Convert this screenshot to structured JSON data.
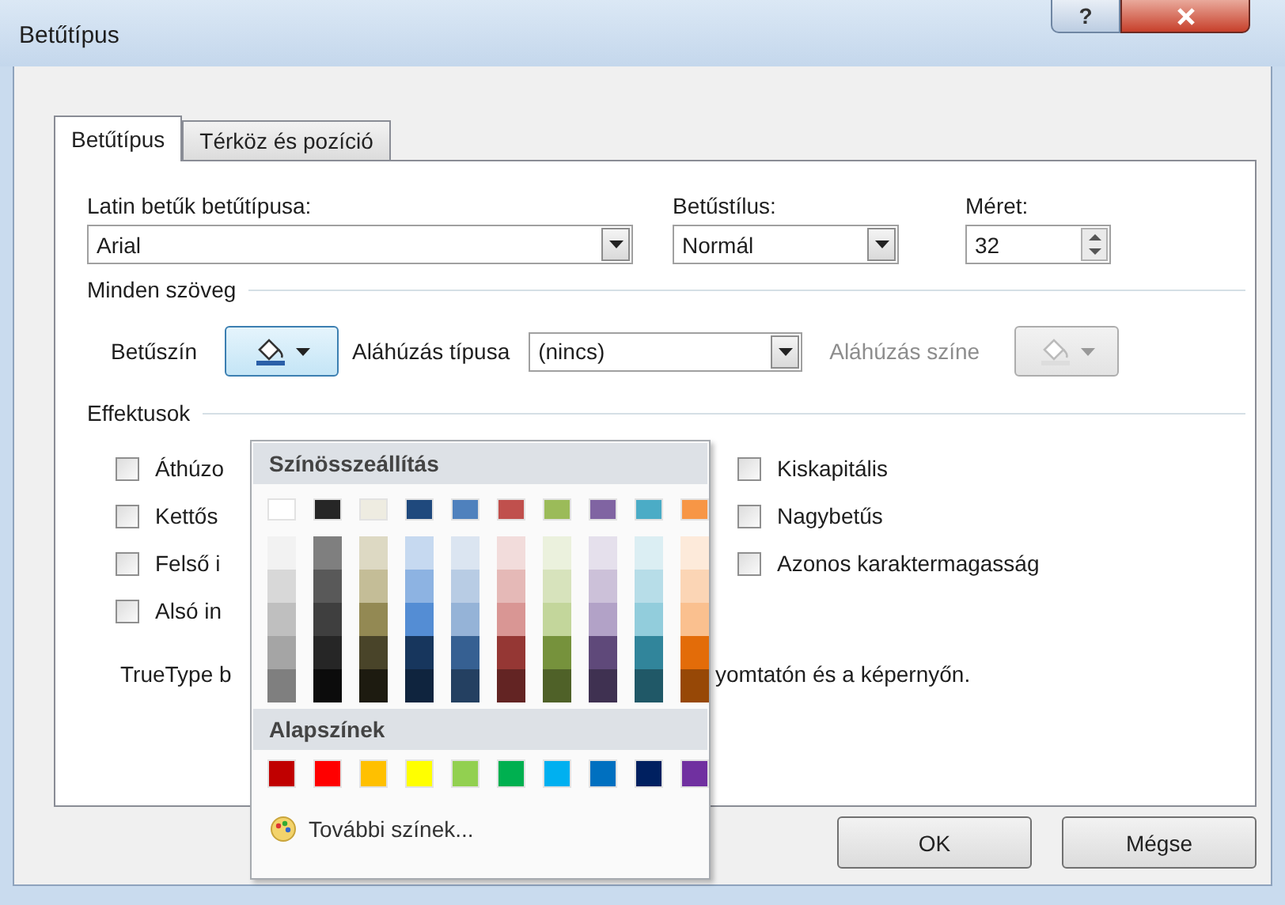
{
  "window": {
    "title": "Betűtípus",
    "help": "?"
  },
  "tabs": [
    {
      "label": "Betűtípus",
      "selected": true
    },
    {
      "label": "Térköz és pozíció",
      "selected": false
    }
  ],
  "font": {
    "label": "Latin betűk betűtípusa:",
    "value": "Arial"
  },
  "style": {
    "label": "Betűstílus:",
    "value": "Normál"
  },
  "size": {
    "label": "Méret:",
    "value": "32"
  },
  "all_text": {
    "heading": "Minden szöveg",
    "font_color_label": "Betűszín",
    "font_color_open": true,
    "underline_label": "Aláhúzás típusa",
    "underline_value": "(nincs)",
    "underline_color": {
      "label": "Aláhúzás színe",
      "disabled": true
    }
  },
  "effects": {
    "heading": "Effektusok",
    "left_options": [
      {
        "label": "Áthúzo",
        "checked": false
      },
      {
        "label": "Kettős",
        "checked": false
      },
      {
        "label": "Felső i",
        "checked": false
      },
      {
        "label": "Alsó in",
        "checked": false
      }
    ],
    "right_options": [
      {
        "label": "Kiskapitális",
        "checked": false
      },
      {
        "label": "Nagybetűs",
        "checked": false
      },
      {
        "label": "Azonos karaktermagasság",
        "checked": false
      }
    ]
  },
  "note": {
    "parts": [
      "TrueType b",
      "yomtatón és a képernyőn."
    ]
  },
  "color_menu": {
    "theme_heading": "Színösszeállítás",
    "theme_colors": [
      {
        "color": "#ffffff",
        "shades": [
          {
            "color": "#f2f2f2"
          },
          {
            "color": "#d8d8d8"
          },
          {
            "color": "#bfbfbf"
          },
          {
            "color": "#a5a5a5"
          },
          {
            "color": "#7f7f7f"
          }
        ]
      },
      {
        "color": "#262626",
        "shades": [
          {
            "color": "#7f7f7f"
          },
          {
            "color": "#595959"
          },
          {
            "color": "#3f3f3f"
          },
          {
            "color": "#262626"
          },
          {
            "color": "#0c0c0c"
          }
        ]
      },
      {
        "color": "#eeece1",
        "shades": [
          {
            "color": "#ddd9c3"
          },
          {
            "color": "#c4bd97"
          },
          {
            "color": "#938953"
          },
          {
            "color": "#494429"
          },
          {
            "color": "#1d1b10"
          }
        ]
      },
      {
        "color": "#1f497d",
        "shades": [
          {
            "color": "#c6d9f0"
          },
          {
            "color": "#8db3e2"
          },
          {
            "color": "#548dd4"
          },
          {
            "color": "#17365d"
          },
          {
            "color": "#0f243e"
          }
        ]
      },
      {
        "color": "#4f81bd",
        "shades": [
          {
            "color": "#dbe5f1"
          },
          {
            "color": "#b8cce4"
          },
          {
            "color": "#95b3d7"
          },
          {
            "color": "#366092"
          },
          {
            "color": "#244061"
          }
        ]
      },
      {
        "color": "#c0504d",
        "shades": [
          {
            "color": "#f2dcdb"
          },
          {
            "color": "#e5b9b7"
          },
          {
            "color": "#d99694"
          },
          {
            "color": "#953734"
          },
          {
            "color": "#632423"
          }
        ]
      },
      {
        "color": "#9bbb59",
        "shades": [
          {
            "color": "#ebf1dd"
          },
          {
            "color": "#d7e3bc"
          },
          {
            "color": "#c3d69b"
          },
          {
            "color": "#76923c"
          },
          {
            "color": "#4f6128"
          }
        ]
      },
      {
        "color": "#8064a2",
        "shades": [
          {
            "color": "#e5e0ec"
          },
          {
            "color": "#ccc1d9"
          },
          {
            "color": "#b2a2c7"
          },
          {
            "color": "#5f497a"
          },
          {
            "color": "#3f3151"
          }
        ]
      },
      {
        "color": "#4bacc6",
        "shades": [
          {
            "color": "#dbeef3"
          },
          {
            "color": "#b7dde8"
          },
          {
            "color": "#92cddc"
          },
          {
            "color": "#31859b"
          },
          {
            "color": "#205867"
          }
        ]
      },
      {
        "color": "#f79646",
        "shades": [
          {
            "color": "#fdeada"
          },
          {
            "color": "#fbd5b5"
          },
          {
            "color": "#fac08f"
          },
          {
            "color": "#e36c09"
          },
          {
            "color": "#974806"
          }
        ]
      }
    ],
    "standard_heading": "Alapszínek",
    "standard_colors": [
      {
        "color": "#c00000"
      },
      {
        "color": "#ff0000"
      },
      {
        "color": "#ffc000"
      },
      {
        "color": "#ffff00"
      },
      {
        "color": "#92d050"
      },
      {
        "color": "#00b050"
      },
      {
        "color": "#00b0f0"
      },
      {
        "color": "#0070c0"
      },
      {
        "color": "#002060"
      },
      {
        "color": "#7030a0"
      }
    ],
    "more_colors": "További színek..."
  },
  "buttons": [
    {
      "label": "OK"
    },
    {
      "label": "Mégse"
    }
  ]
}
